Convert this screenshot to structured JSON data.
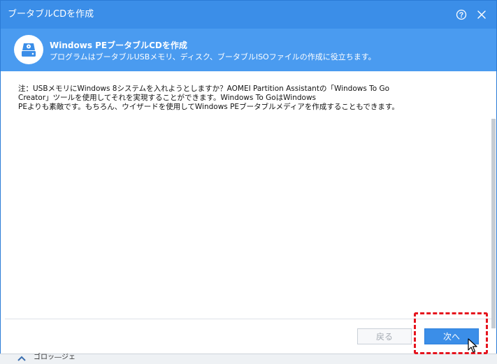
{
  "window": {
    "title": "ブータブルCDを作成"
  },
  "titlebar_icons": {
    "help": "help-icon",
    "close": "close-icon"
  },
  "banner": {
    "icon": "disc-drive-icon",
    "title": "Windows PEブータブルCDを作成",
    "subtitle": "プログラムはブータブルUSBメモリ、ディスク、ブータブルISOファイルの作成に役立ちます。"
  },
  "content": {
    "lines": [
      "注：USBメモリにWindows 8システムを入れようとしますか？AOMEI Partition Assistantの「Windows To Go",
      "Creator」ツールを使用してそれを実現することができます。Windows To GoはWindows",
      "PEよりも素敵です。もちろん、ウイザードを使用してWindows PEブータブルメディアを作成することもできます。"
    ]
  },
  "footer": {
    "back_label": "戻る",
    "next_label": "次へ"
  },
  "background": {
    "partial_item_label": "ゴロッ―ジェ"
  },
  "colors": {
    "titlebar": "#3b8ee8",
    "banner": "#4a9bf0",
    "accent": "#3b8ee8",
    "highlight": "#e5141e"
  }
}
